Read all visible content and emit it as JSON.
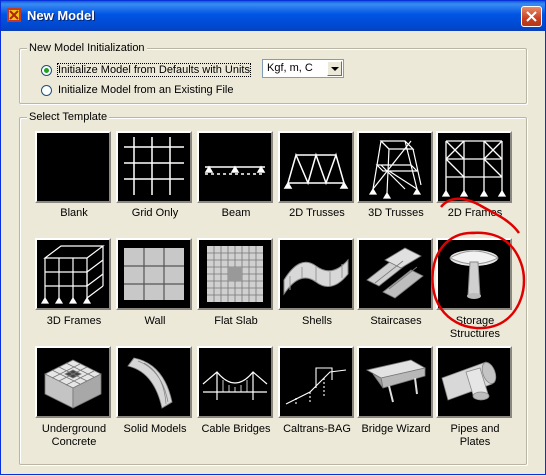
{
  "window": {
    "title": "New Model",
    "close_label": "close"
  },
  "init": {
    "group_title": "New Model Initialization",
    "options": [
      {
        "label": "Initialize Model from Defaults with Units",
        "checked": true
      },
      {
        "label": "Initialize Model  from an Existing File",
        "checked": false
      }
    ],
    "units_value": "Kgf, m, C"
  },
  "templates": {
    "group_title": "Select Template",
    "items": [
      {
        "label": "Blank",
        "icon": "blank-icon"
      },
      {
        "label": "Grid Only",
        "icon": "grid-only-icon"
      },
      {
        "label": "Beam",
        "icon": "beam-icon"
      },
      {
        "label": "2D Trusses",
        "icon": "2d-trusses-icon"
      },
      {
        "label": "3D Trusses",
        "icon": "3d-trusses-icon"
      },
      {
        "label": "2D Frames",
        "icon": "2d-frames-icon"
      },
      {
        "label": "3D Frames",
        "icon": "3d-frames-icon"
      },
      {
        "label": "Wall",
        "icon": "wall-icon"
      },
      {
        "label": "Flat Slab",
        "icon": "flat-slab-icon"
      },
      {
        "label": "Shells",
        "icon": "shells-icon"
      },
      {
        "label": "Staircases",
        "icon": "staircases-icon"
      },
      {
        "label": "Storage\nStructures",
        "icon": "storage-structures-icon"
      },
      {
        "label": "Underground\nConcrete",
        "icon": "underground-concrete-icon"
      },
      {
        "label": "Solid Models",
        "icon": "solid-models-icon"
      },
      {
        "label": "Cable Bridges",
        "icon": "cable-bridges-icon"
      },
      {
        "label": "Caltrans-BAG",
        "icon": "caltrans-bag-icon"
      },
      {
        "label": "Bridge Wizard",
        "icon": "bridge-wizard-icon"
      },
      {
        "label": "Pipes and\nPlates",
        "icon": "pipes-and-plates-icon"
      }
    ]
  },
  "colors": {
    "title_bar": "#0054e3",
    "dialog_bg": "#ece9d8",
    "tile_bg": "#000000",
    "annotation": "#e00000"
  }
}
